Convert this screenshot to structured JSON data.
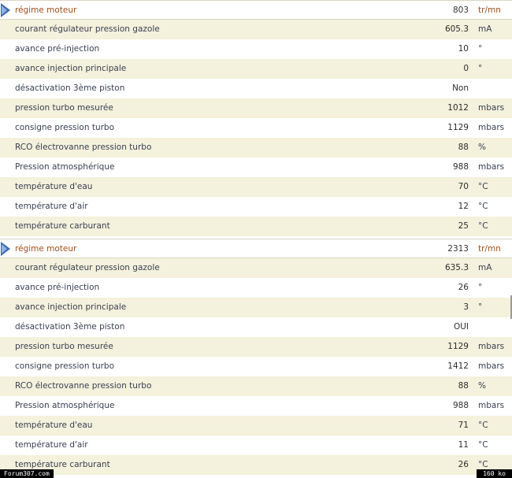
{
  "colors": {
    "header_text": "#a04e18",
    "row_alt": "#f4f1dc",
    "label_text": "#3a3f52",
    "arrow": "#3f66a8"
  },
  "blocks": [
    {
      "header": {
        "label": "régime moteur",
        "value": "803",
        "unit": "tr/mn"
      },
      "rows": [
        {
          "label": "courant régulateur pression gazole",
          "value": "605.3",
          "unit": "mA"
        },
        {
          "label": "avance pré-injection",
          "value": "10",
          "unit": "°"
        },
        {
          "label": "avance injection principale",
          "value": "0",
          "unit": "°"
        },
        {
          "label": "désactivation 3ème piston",
          "value": "Non",
          "unit": ""
        },
        {
          "label": "pression turbo mesurée",
          "value": "1012",
          "unit": "mbars"
        },
        {
          "label": "consigne pression turbo",
          "value": "1129",
          "unit": "mbars"
        },
        {
          "label": "RCO électrovanne pression turbo",
          "value": "88",
          "unit": "%"
        },
        {
          "label": "Pression atmosphérique",
          "value": "988",
          "unit": "mbars"
        },
        {
          "label": "température d'eau",
          "value": "70",
          "unit": "°C"
        },
        {
          "label": "température d'air",
          "value": "12",
          "unit": "°C"
        },
        {
          "label": "température carburant",
          "value": "25",
          "unit": "°C"
        }
      ]
    },
    {
      "header": {
        "label": "régime moteur",
        "value": "2313",
        "unit": "tr/mn"
      },
      "rows": [
        {
          "label": "courant régulateur pression gazole",
          "value": "635.3",
          "unit": "mA"
        },
        {
          "label": "avance pré-injection",
          "value": "26",
          "unit": "°"
        },
        {
          "label": "avance injection principale",
          "value": "3",
          "unit": "°"
        },
        {
          "label": "désactivation 3ème piston",
          "value": "OUI",
          "unit": ""
        },
        {
          "label": "pression turbo mesurée",
          "value": "1129",
          "unit": "mbars"
        },
        {
          "label": "consigne pression turbo",
          "value": "1412",
          "unit": "mbars"
        },
        {
          "label": "RCO électrovanne pression turbo",
          "value": "88",
          "unit": "%"
        },
        {
          "label": "Pression atmosphérique",
          "value": "988",
          "unit": "mbars"
        },
        {
          "label": "température d'eau",
          "value": "71",
          "unit": "°C"
        },
        {
          "label": "température d'air",
          "value": "11",
          "unit": "°C"
        },
        {
          "label": "température carburant",
          "value": "26",
          "unit": "°C"
        }
      ]
    }
  ],
  "footer": {
    "source": "Forum307.com",
    "size": "160 ko"
  }
}
